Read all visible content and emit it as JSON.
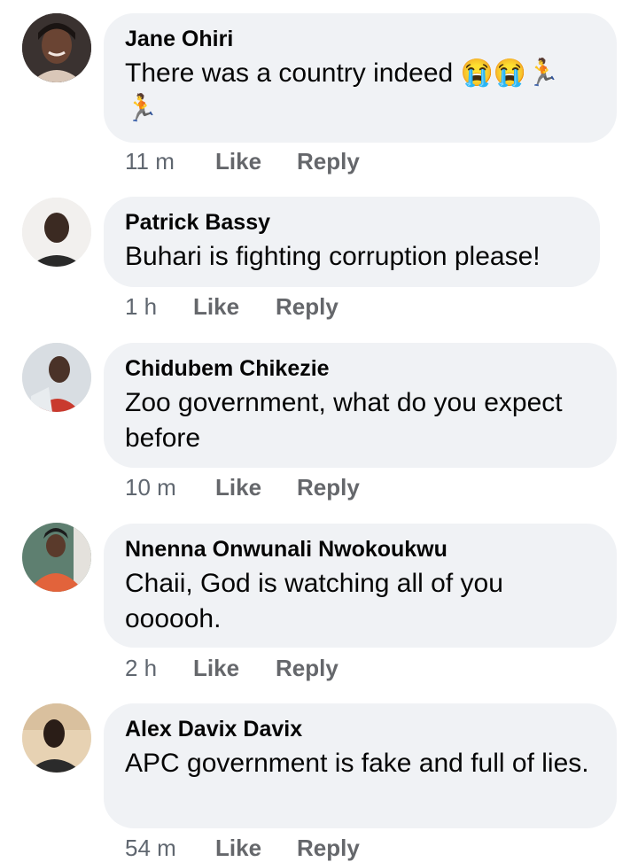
{
  "comments": [
    {
      "author": "Jane Ohiri",
      "text": "There was a country indeed 😭😭🏃",
      "text2": "🏃",
      "time": "11 m",
      "like": "Like",
      "reply": "Reply",
      "avatar": "avatar-woman-icon"
    },
    {
      "author": "Patrick Bassy",
      "text": "Buhari is fighting corruption please!",
      "time": "1 h",
      "like": "Like",
      "reply": "Reply",
      "avatar": "avatar-man-icon"
    },
    {
      "author": "Chidubem Chikezie",
      "text": "Zoo government, what do you expect before",
      "time": "10 m",
      "like": "Like",
      "reply": "Reply",
      "avatar": "avatar-man-icon"
    },
    {
      "author": "Nnenna Onwunali Nwokoukwu",
      "text": "Chaii, God is watching all  of you oooooh.",
      "time": "2 h",
      "like": "Like",
      "reply": "Reply",
      "avatar": "avatar-woman-icon"
    },
    {
      "author": "Alex Davix Davix",
      "text": "APC government is fake and full of lies.",
      "time": "54 m",
      "like": "Like",
      "reply": "Reply",
      "avatar": "avatar-man-icon"
    }
  ]
}
